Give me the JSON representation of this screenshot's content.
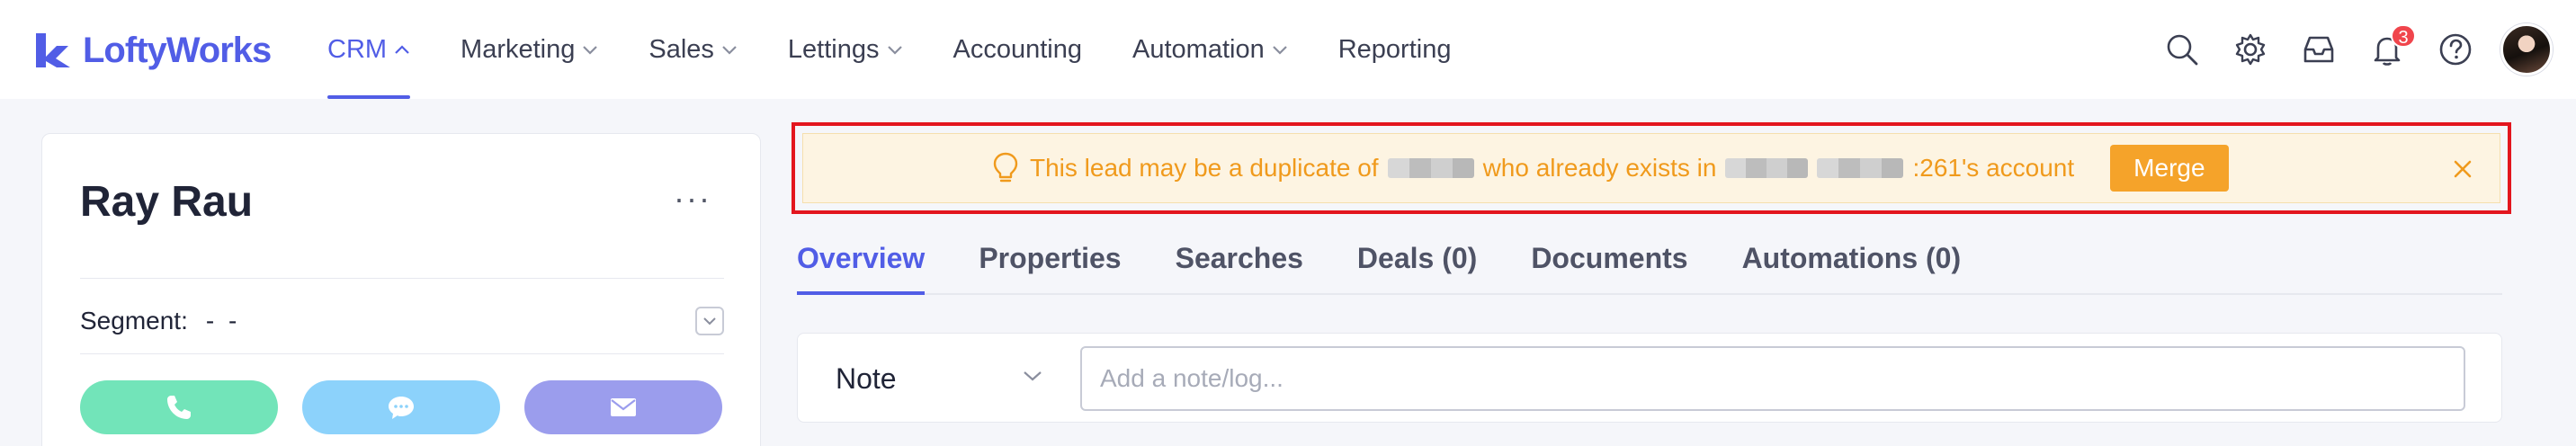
{
  "brand": {
    "name": "LoftyWorks",
    "color": "#515de6"
  },
  "nav": {
    "items": [
      {
        "label": "CRM",
        "has_dropdown": true,
        "active": true
      },
      {
        "label": "Marketing",
        "has_dropdown": true,
        "active": false
      },
      {
        "label": "Sales",
        "has_dropdown": true,
        "active": false
      },
      {
        "label": "Lettings",
        "has_dropdown": true,
        "active": false
      },
      {
        "label": "Accounting",
        "has_dropdown": false,
        "active": false
      },
      {
        "label": "Automation",
        "has_dropdown": true,
        "active": false
      },
      {
        "label": "Reporting",
        "has_dropdown": false,
        "active": false
      }
    ]
  },
  "header_icons": {
    "search": "search-icon",
    "settings": "gear-icon",
    "inbox": "inbox-icon",
    "notifications": "bell-icon",
    "notification_count": "3",
    "help": "help-icon",
    "avatar": "user-avatar"
  },
  "lead": {
    "name": "Ray Rau",
    "more": "···",
    "segment_label": "Segment:",
    "segment_value": "- -",
    "actions": [
      "phone-icon",
      "chat-icon",
      "mail-icon"
    ]
  },
  "duplicate_banner": {
    "text_before": "This lead may be a duplicate of",
    "text_middle": "who already exists in",
    "text_after": ":261's account",
    "merge_label": "Merge",
    "highlight_color": "#e3161e",
    "text_color": "#f09a1c"
  },
  "tabs": [
    {
      "label": "Overview",
      "active": true
    },
    {
      "label": "Properties",
      "active": false
    },
    {
      "label": "Searches",
      "active": false
    },
    {
      "label": "Deals (0)",
      "active": false
    },
    {
      "label": "Documents",
      "active": false
    },
    {
      "label": "Automations (0)",
      "active": false
    }
  ],
  "note": {
    "type": "Note",
    "placeholder": "Add a note/log..."
  }
}
